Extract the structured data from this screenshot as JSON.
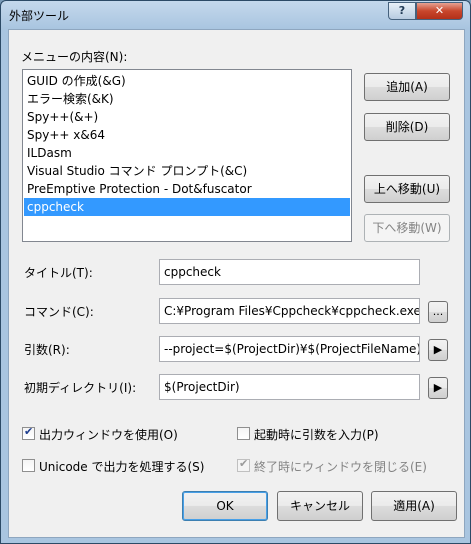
{
  "window": {
    "title": "外部ツール",
    "help_label": "?",
    "close_label": "✕"
  },
  "list": {
    "label": "メニューの内容(N):",
    "items": [
      "GUID の作成(&G)",
      "エラー検索(&K)",
      "Spy++(&+)",
      "Spy++ x&64",
      "ILDasm",
      "Visual Studio コマンド プロンプト(&C)",
      "PreEmptive Protection - Dot&fuscator",
      "cppcheck"
    ],
    "selected": "cppcheck"
  },
  "side_buttons": {
    "add": "追加(A)",
    "delete": "削除(D)",
    "move_up": "上へ移動(U)",
    "move_down": "下へ移動(W)"
  },
  "fields": {
    "title_label": "タイトル(T):",
    "title_value": "cppcheck",
    "command_label": "コマンド(C):",
    "command_value": "C:¥Program Files¥Cppcheck¥cppcheck.exe",
    "browse_label": "...",
    "args_label": "引数(R):",
    "args_value": "--project=$(ProjectDir)¥$(ProjectFileName)",
    "initdir_label": "初期ディレクトリ(I):",
    "initdir_value": "$(ProjectDir)",
    "arrow_glyph": "▶"
  },
  "checkboxes": {
    "use_output": {
      "label": "出力ウィンドウを使用(O)",
      "checked": true
    },
    "prompt_args": {
      "label": "起動時に引数を入力(P)",
      "checked": false
    },
    "unicode": {
      "label": "Unicode で出力を処理する(S)",
      "checked": false
    },
    "close_on_exit": {
      "label": "終了時にウィンドウを閉じる(E)",
      "checked": true
    },
    "check_glyph": "✔"
  },
  "buttons": {
    "ok": "OK",
    "cancel": "キャンセル",
    "apply": "適用(A)"
  }
}
